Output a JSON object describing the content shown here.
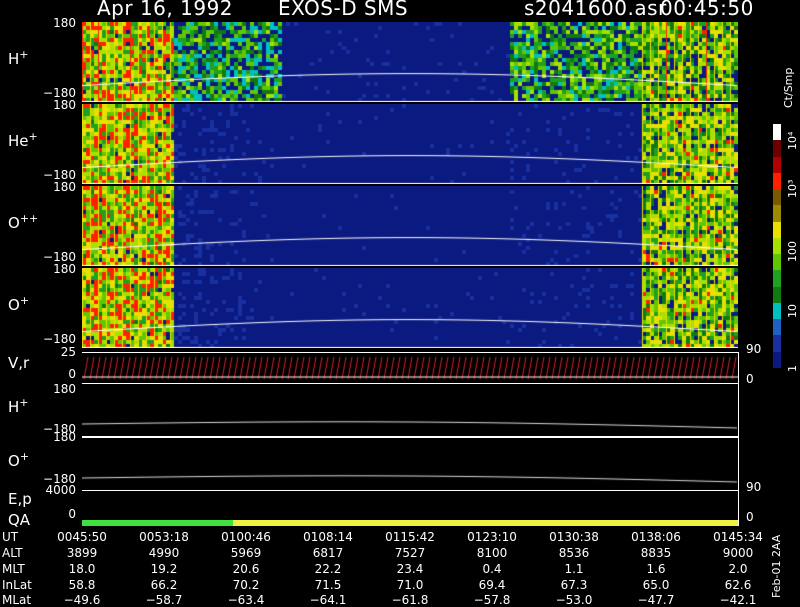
{
  "header": {
    "date": "Apr 16, 1992",
    "mission": "EXOS-D SMS",
    "file": "s2041600.asr",
    "time": "00:45:50"
  },
  "panels": [
    {
      "label": "H",
      "sup": "+",
      "top": "180",
      "bottom": "−180",
      "kind": "spec",
      "density": "h"
    },
    {
      "label": "He",
      "sup": "+",
      "top": "180",
      "bottom": "−180",
      "kind": "spec",
      "density": "he"
    },
    {
      "label": "O",
      "sup": "++",
      "top": "180",
      "bottom": "−180",
      "kind": "spec",
      "density": "opp"
    },
    {
      "label": "O",
      "sup": "+",
      "top": "180",
      "bottom": "−180",
      "kind": "spec",
      "density": "op"
    }
  ],
  "line_panels": {
    "vr": {
      "label": "V,r",
      "left_top": "25",
      "left_mid": "0",
      "right_top": "90",
      "right_bottom": "0"
    },
    "h_line": {
      "label": "H",
      "sup": "+",
      "top": "180",
      "bottom": "−180"
    },
    "o_line": {
      "label": "O",
      "sup": "+",
      "top": "180",
      "bottom": "−180"
    },
    "ep": {
      "label": "E,p",
      "left_top": "4000",
      "right_mid": "90"
    },
    "qa": {
      "label": "QA",
      "left_bottom": "0",
      "right_bottom": "0"
    }
  },
  "colorbar": {
    "unit": "Ct/Smp",
    "ticks": [
      "10⁴",
      "10³",
      "100",
      "10",
      "1"
    ],
    "colors": [
      "#ffffff",
      "#6b0000",
      "#b00000",
      "#ff2000",
      "#7a5a00",
      "#9c8a00",
      "#e8e000",
      "#a8e000",
      "#60c800",
      "#20a020",
      "#107a10",
      "#00c0c0",
      "#2060c0",
      "#1830a0",
      "#0a1a80"
    ]
  },
  "footer": {
    "keys": [
      "UT",
      "ALT",
      "MLT",
      "InLat",
      "MLat"
    ],
    "columns": [
      {
        "UT": "0045:50",
        "ALT": "3899",
        "MLT": "18.0",
        "InLat": "58.8",
        "MLat": "−49.6"
      },
      {
        "UT": "0053:18",
        "ALT": "4990",
        "MLT": "19.2",
        "InLat": "66.2",
        "MLat": "−58.7"
      },
      {
        "UT": "0100:46",
        "ALT": "5969",
        "MLT": "20.6",
        "InLat": "70.2",
        "MLat": "−63.4"
      },
      {
        "UT": "0108:14",
        "ALT": "6817",
        "MLT": "22.2",
        "InLat": "71.5",
        "MLat": "−64.1"
      },
      {
        "UT": "0115:42",
        "ALT": "7527",
        "MLT": "23.4",
        "InLat": "71.0",
        "MLat": "−61.8"
      },
      {
        "UT": "0123:10",
        "ALT": "8100",
        "MLT": "0.4",
        "InLat": "69.4",
        "MLat": "−57.8"
      },
      {
        "UT": "0130:38",
        "ALT": "8536",
        "MLT": "1.1",
        "InLat": "67.3",
        "MLat": "−53.0"
      },
      {
        "UT": "0138:06",
        "ALT": "8835",
        "MLT": "1.6",
        "InLat": "65.0",
        "MLat": "−47.7"
      },
      {
        "UT": "0145:34",
        "ALT": "9000",
        "MLT": "2.0",
        "InLat": "62.6",
        "MLat": "−42.1"
      }
    ],
    "stamp": "Feb-01 2AA"
  },
  "qa_segments": [
    {
      "color": "#40e040",
      "fraction": 0.23
    },
    {
      "color": "#f0f040",
      "fraction": 0.77
    }
  ]
}
